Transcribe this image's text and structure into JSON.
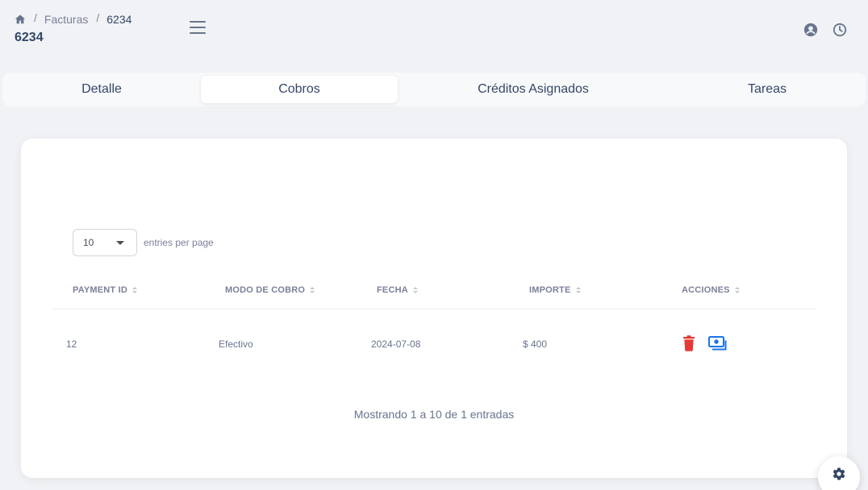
{
  "breadcrumb": {
    "section": "Facturas",
    "current": "6234",
    "separator": "/"
  },
  "page": {
    "title": "6234"
  },
  "tabs": [
    {
      "label": "Detalle",
      "active": false
    },
    {
      "label": "Cobros",
      "active": true
    },
    {
      "label": "Créditos Asignados",
      "active": false
    },
    {
      "label": "Tareas",
      "active": false
    }
  ],
  "table_controls": {
    "page_size": "10",
    "page_size_label": "entries per page"
  },
  "table": {
    "headers": [
      "PAYMENT ID",
      "MODO DE COBRO",
      "FECHA",
      "IMPORTE",
      "ACCIONES"
    ],
    "rows": [
      {
        "payment_id": "12",
        "modo": "Efectivo",
        "fecha": "2024-07-08",
        "importe": "$ 400"
      }
    ]
  },
  "pagination": {
    "info": "Mostrando 1 a 10 de 1 entradas"
  },
  "icons": {
    "home": "home-icon",
    "menu": "hamburger-menu-icon",
    "user": "user-circle-icon",
    "clock": "clock-icon",
    "delete": "trash-icon",
    "payment": "money-bill-icon",
    "settings": "gear-icon"
  },
  "colors": {
    "delete": "#e53935",
    "payment": "#1a73e8",
    "text": "#344767",
    "muted": "#7b809a"
  }
}
